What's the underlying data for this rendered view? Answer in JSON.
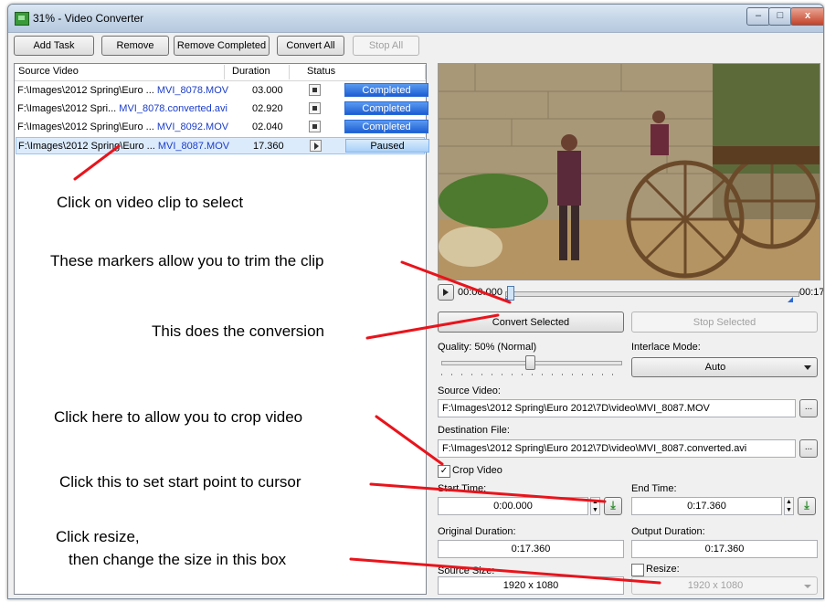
{
  "window": {
    "title": "31% - Video Converter",
    "min_label": "–",
    "max_label": "□",
    "close_label": "x"
  },
  "toolbar": {
    "add_task": "Add Task",
    "remove": "Remove",
    "remove_completed": "Remove Completed",
    "convert_all": "Convert All",
    "stop_all": "Stop All"
  },
  "list": {
    "headers": {
      "source": "Source Video",
      "duration": "Duration",
      "status": "Status"
    },
    "rows": [
      {
        "path": "F:\\Images\\2012 Spring\\Euro ... ",
        "file": "MVI_8078.MOV",
        "duration": "03.000",
        "status": "Completed"
      },
      {
        "path": "F:\\Images\\2012 Spri... ",
        "file": "MVI_8078.converted.avi",
        "duration": "02.920",
        "status": "Completed"
      },
      {
        "path": "F:\\Images\\2012 Spring\\Euro ... ",
        "file": "MVI_8092.MOV",
        "duration": "02.040",
        "status": "Completed"
      },
      {
        "path": "F:\\Images\\2012 Spring\\Euro ... ",
        "file": "MVI_8087.MOV",
        "duration": "17.360",
        "status": "Paused"
      }
    ]
  },
  "player": {
    "current_time": "00:00.000",
    "end_time": "00:17"
  },
  "actions": {
    "convert_selected": "Convert Selected",
    "stop_selected": "Stop Selected"
  },
  "quality": {
    "label": "Quality: 50% (Normal)",
    "level": 0.5
  },
  "interlace": {
    "label": "Interlace Mode:",
    "value": "Auto"
  },
  "source": {
    "label": "Source Video:",
    "value": "F:\\Images\\2012 Spring\\Euro 2012\\7D\\video\\MVI_8087.MOV",
    "browse": "..."
  },
  "destination": {
    "label": "Destination File:",
    "value": "F:\\Images\\2012 Spring\\Euro 2012\\7D\\video\\MVI_8087.converted.avi",
    "browse": "..."
  },
  "crop": {
    "label": "Crop Video",
    "checked": true
  },
  "start_time": {
    "label": "Start Time:",
    "value": "0:00.000"
  },
  "end_time": {
    "label": "End Time:",
    "value": "0:17.360"
  },
  "original_duration": {
    "label": "Original Duration:",
    "value": "0:17.360"
  },
  "output_duration": {
    "label": "Output Duration:",
    "value": "0:17.360"
  },
  "source_size": {
    "label": "Source Size:",
    "value": "1920 x 1080"
  },
  "resize": {
    "label": "Resize:",
    "value": "1920 x 1080",
    "checked": false
  },
  "annotations": {
    "select_clip": "Click on video clip to select",
    "markers": "These markers allow you to trim the clip",
    "conversion": "This does the conversion",
    "crop": "Click here to allow you to crop video",
    "start_point": "Click this to set start point to cursor",
    "resize_line1": "Click resize,",
    "resize_line2": "then change the size in this box"
  },
  "colors": {
    "arrow": "#e8141c",
    "progress_complete": "#1d5fd4",
    "link": "#1a3cc8"
  }
}
